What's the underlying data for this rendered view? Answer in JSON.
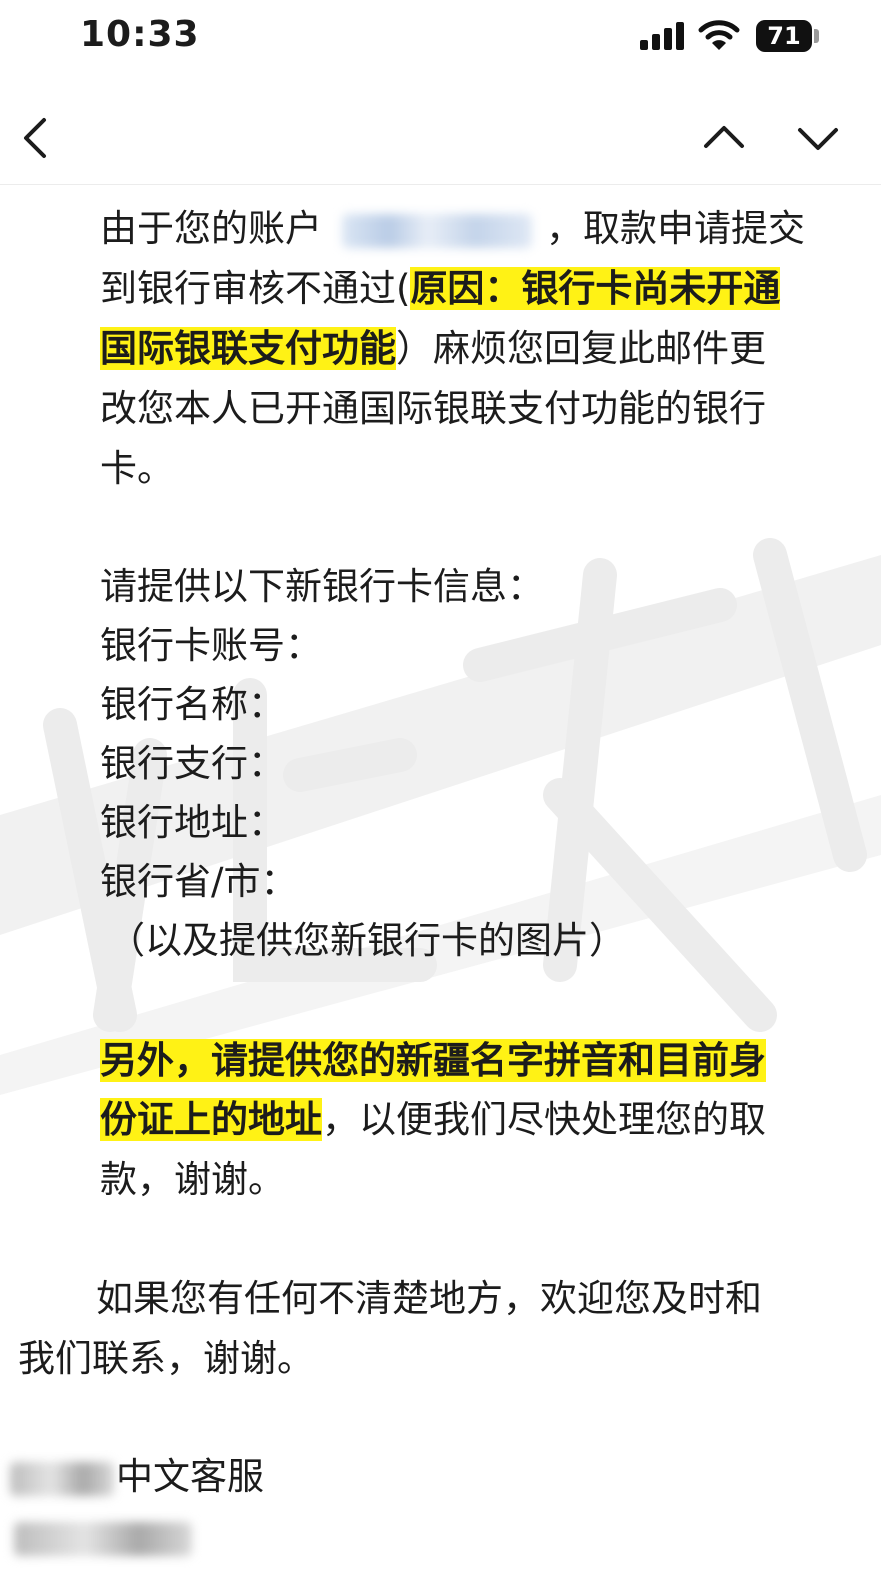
{
  "status_bar": {
    "time": "10:33",
    "battery_level": "71",
    "signal_bars": 4,
    "signal_icon": "cellular-signal-icon",
    "wifi_icon": "wifi-icon",
    "battery_icon": "battery-icon"
  },
  "nav": {
    "back_icon": "chevron-left-icon",
    "prev_icon": "chevron-up-icon",
    "next_icon": "chevron-down-icon"
  },
  "email": {
    "line1_a": "由于您的账户",
    "line1_b": "，取款申请提交",
    "line2_a": "到银行审核不通过(",
    "line2_highlight": "原因：银行卡尚未开通",
    "line3_highlight": "国际银联支付功能",
    "line3_b": "）麻烦您回复此邮件更",
    "line4": "改您本人已开通国际银联支付功能的银行",
    "line5": "卡。",
    "info_intro": "请提供以下新银行卡信息：",
    "field_account": "银行卡账号：",
    "field_bank_name": "银行名称：",
    "field_branch": "银行支行：",
    "field_address": "银行地址：",
    "field_province": "银行省/市：",
    "photo_note": "（以及提供您新银行卡的图片）",
    "extra_highlight_1": "另外，请提供您的新疆名字拼音和目前身",
    "extra_highlight_2": "份证上的地址",
    "extra_rest_2": "，以便我们尽快处理您的取",
    "extra_line3": "款，谢谢。",
    "contact_line1": "如果您有任何不清楚地方，欢迎您及时和",
    "contact_line2": "我们联系，谢谢。",
    "signature_suffix": "中文客服"
  },
  "colors": {
    "highlight": "#fff215",
    "text": "#1c1c1c",
    "watermark": "#eeeeee"
  }
}
